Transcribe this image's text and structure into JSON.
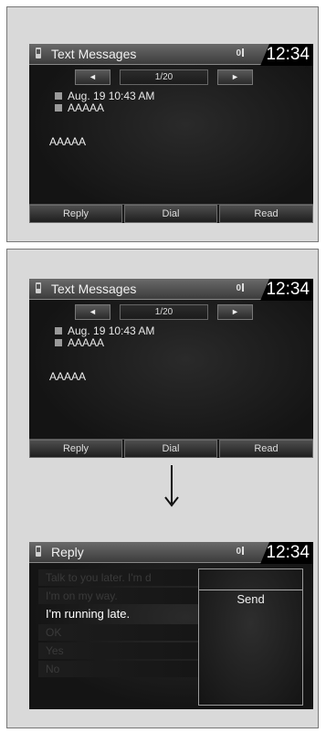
{
  "common": {
    "title": "Text Messages",
    "clock": "12:34",
    "status": "0",
    "prev": "◄",
    "next": "►",
    "page": "1/20",
    "date": "Aug. 19 10:43 AM",
    "sender": "AAAAA",
    "message": "AAAAA",
    "softkeys": [
      "Reply",
      "Dial",
      "Read"
    ]
  },
  "reply_screen": {
    "title": "Reply",
    "clock": "12:34",
    "status": "0",
    "items": [
      "Talk to you later. I'm d",
      "I'm on my way.",
      "I'm running late.",
      "OK",
      "Yes",
      "No"
    ],
    "active_index": 2,
    "send_label": "Send"
  },
  "arrow": "down-arrow"
}
